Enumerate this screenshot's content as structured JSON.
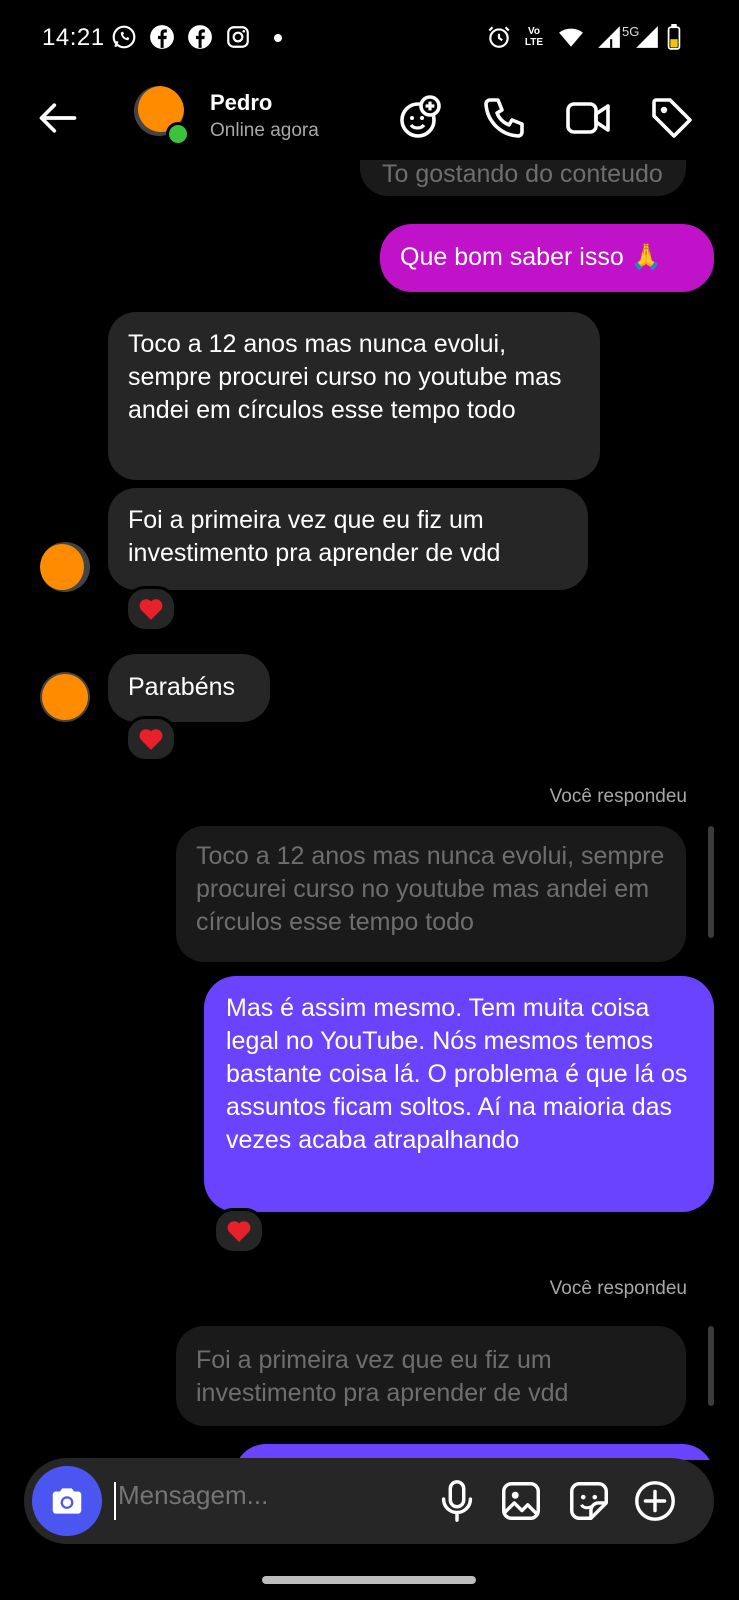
{
  "status_bar": {
    "time": "14:21",
    "network_label": "5G",
    "volte_label": "Vo LTE"
  },
  "header": {
    "contact_name": "Pedro",
    "presence": "Online agora"
  },
  "messages": {
    "partial_top": "To gostando do conteudo",
    "out_1": "Que bom saber isso 🙏",
    "in_1": "Toco a 12 anos mas nunca evolui, sempre procurei curso no youtube mas andei em círculos esse tempo todo",
    "in_2": "Foi a primeira vez que eu fiz um investimento pra aprender de vdd",
    "in_3": "Parabéns",
    "reply_label_1": "Você respondeu",
    "quoted_1": "Toco a 12 anos mas nunca evolui, sempre procurei curso no youtube mas andei em círculos esse tempo todo",
    "out_2": "Mas é assim mesmo. Tem muita coisa legal no YouTube. Nós mesmos temos bastante coisa lá. O problema é que lá os assuntos ficam soltos. Aí na maioria das vezes acaba atrapalhando",
    "reply_label_2": "Você respondeu",
    "quoted_2": "Foi a primeira vez que eu fiz um investimento pra aprender de vdd"
  },
  "reaction": "❤️",
  "composer": {
    "placeholder": "Mensagem..."
  },
  "colors": {
    "accent_pink": "#c013c9",
    "accent_purple": "#6a43ff",
    "camera_button": "#4b55f0",
    "incoming_bubble": "#262626"
  },
  "icons": [
    "whatsapp-icon",
    "facebook-icon",
    "instagram-icon",
    "alarm-icon",
    "wifi-icon",
    "signal-icon",
    "battery-icon",
    "back-arrow-icon",
    "add-effect-icon",
    "phone-icon",
    "video-icon",
    "tag-icon",
    "heart-reaction-icon",
    "camera-icon",
    "microphone-icon",
    "gallery-icon",
    "sticker-icon",
    "plus-icon"
  ]
}
